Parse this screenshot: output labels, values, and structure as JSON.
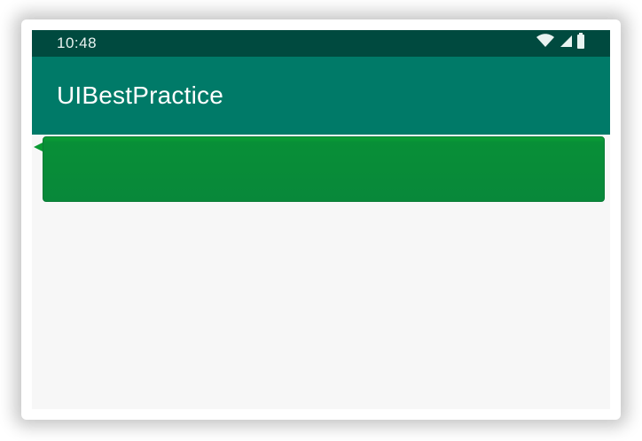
{
  "status_bar": {
    "time": "10:48",
    "icons": [
      "wifi-icon",
      "signal-icon",
      "battery-icon"
    ]
  },
  "app_bar": {
    "title": "UIBestPractice"
  },
  "messages": [
    {
      "text": "",
      "type": "received"
    }
  ],
  "colors": {
    "status_bar": "#004a3f",
    "app_bar": "#007a68",
    "background": "#f7f7f7",
    "bubble": "#08883a"
  }
}
